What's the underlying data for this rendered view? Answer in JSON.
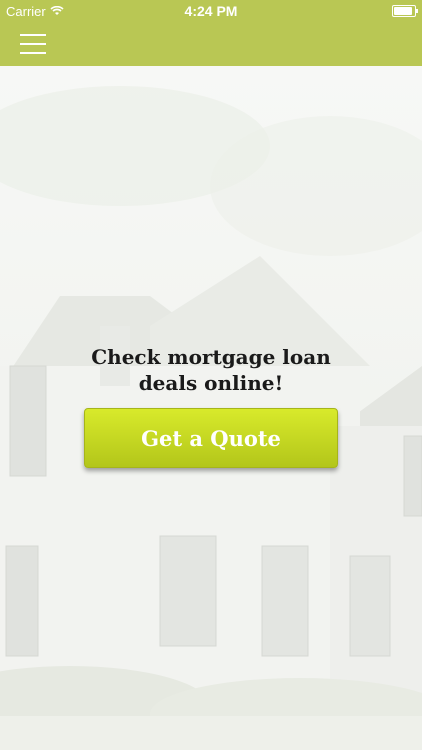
{
  "status_bar": {
    "carrier": "Carrier",
    "time": "4:24 PM"
  },
  "nav": {
    "menu_icon": "hamburger-menu-icon"
  },
  "hero": {
    "headline_line1": "Check mortgage loan",
    "headline_line2": "deals online!",
    "cta_label": "Get a Quote"
  },
  "colors": {
    "bar": "#b9c754",
    "cta": "#c8db23",
    "text": "#1a1a1a"
  }
}
